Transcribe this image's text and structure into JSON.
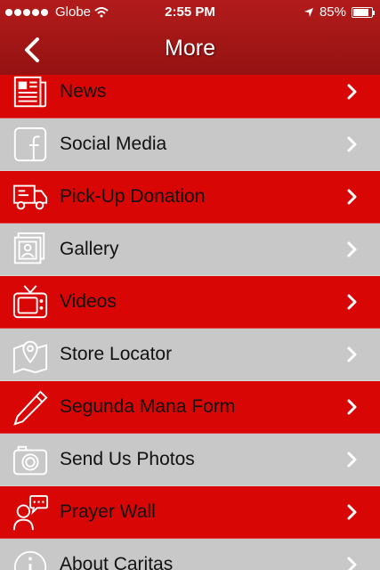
{
  "status": {
    "carrier": "Globe",
    "time": "2:55 PM",
    "battery": "85%",
    "battery_level": 0.85
  },
  "nav": {
    "title": "More",
    "back_icon": "chevron-left-icon"
  },
  "menu": [
    {
      "label": "News",
      "icon": "newspaper-icon",
      "style": "red"
    },
    {
      "label": "Social Media",
      "icon": "facebook-icon",
      "style": "grey"
    },
    {
      "label": "Pick-Up Donation",
      "icon": "truck-icon",
      "style": "red"
    },
    {
      "label": "Gallery",
      "icon": "photos-icon",
      "style": "grey"
    },
    {
      "label": "Videos",
      "icon": "tv-icon",
      "style": "red"
    },
    {
      "label": "Store Locator",
      "icon": "map-pin-icon",
      "style": "grey"
    },
    {
      "label": "Segunda Mana Form",
      "icon": "pencil-icon",
      "style": "red"
    },
    {
      "label": "Send Us Photos",
      "icon": "camera-icon",
      "style": "grey"
    },
    {
      "label": "Prayer Wall",
      "icon": "speech-person-icon",
      "style": "red"
    },
    {
      "label": "About Caritas",
      "icon": "info-icon",
      "style": "grey"
    }
  ],
  "colors": {
    "header": "#a51515",
    "red_row": "#d90606",
    "grey_row": "#c8c8c8"
  }
}
